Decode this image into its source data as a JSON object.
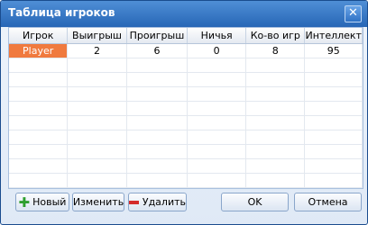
{
  "window": {
    "title": "Таблица игроков",
    "close_glyph": "✕"
  },
  "table": {
    "columns": [
      "Игрок",
      "Выигрыш",
      "Проигрыш",
      "Ничья",
      "Ко-во игр",
      "Интеллект"
    ],
    "rows": [
      [
        "Player",
        "2",
        "6",
        "0",
        "8",
        "95"
      ]
    ]
  },
  "buttons": {
    "new_label": "Новый",
    "edit_label": "Изменить",
    "delete_label": "Удалить",
    "ok_label": "OK",
    "cancel_label": "Отмена"
  },
  "colors": {
    "selected_cell": "#f07a3e",
    "titlebar": "#2f72c2"
  }
}
